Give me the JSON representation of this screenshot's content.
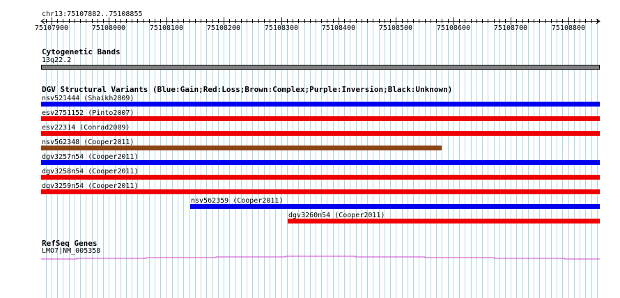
{
  "ruler": {
    "position_label": "chr13:75107882..75108855",
    "ticks": [
      "75107900",
      "75108000",
      "75108100",
      "75108200",
      "75108300",
      "75108400",
      "75108500",
      "75108600",
      "75108700",
      "75108800"
    ]
  },
  "cytoband": {
    "title": "Cytogenetic Bands",
    "band_label": "13q22.2",
    "band_color": "#808080"
  },
  "dgv": {
    "title": "DGV Structural Variants (Blue:Gain;Red:Loss;Brown:Complex;Purple:Inversion;Black:Unknown)",
    "variants": [
      {
        "label": "nsv521444 (Shaikh2009)",
        "start": 75107882,
        "end": 75108855,
        "color": "#0000ee"
      },
      {
        "label": "esv2751152 (Pinto2007)",
        "start": 75107882,
        "end": 75108855,
        "color": "#ee0000"
      },
      {
        "label": "esv22314 (Conrad2009)",
        "start": 75107882,
        "end": 75108855,
        "color": "#ee0000"
      },
      {
        "label": "nsv562348 (Cooper2011)",
        "start": 75107882,
        "end": 75108580,
        "color": "#8b4513"
      },
      {
        "label": "dgv3257n54 (Cooper2011)",
        "start": 75107882,
        "end": 75108855,
        "color": "#0000ee"
      },
      {
        "label": "dgv3258n54 (Cooper2011)",
        "start": 75107882,
        "end": 75108855,
        "color": "#ee0000"
      },
      {
        "label": "dgv3259n54 (Cooper2011)",
        "start": 75107882,
        "end": 75108855,
        "color": "#ee0000"
      },
      {
        "label": "nsv562359 (Cooper2011)",
        "start": 75108142,
        "end": 75108855,
        "color": "#0000ee"
      },
      {
        "label": "dgv3260n54 (Cooper2011)",
        "start": 75108312,
        "end": 75108855,
        "color": "#ee0000"
      }
    ]
  },
  "refseq": {
    "title": "RefSeq Genes",
    "gene_label": "LMO7|NM_005358",
    "line_color": "#cc44cc"
  },
  "colors": {
    "grid": "#aed8e6",
    "ruler": "#000000"
  }
}
